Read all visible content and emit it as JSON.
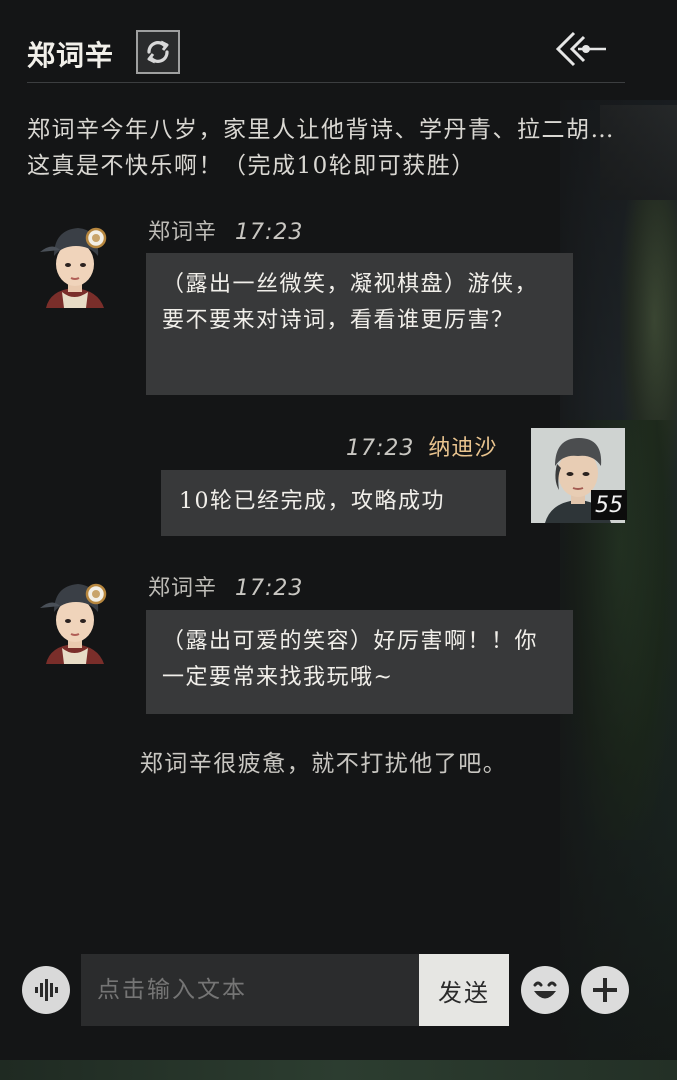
{
  "header": {
    "title": "郑词辛",
    "refresh_icon": "refresh-icon",
    "back_icon": "back-arrow-icon"
  },
  "intro": "郑词辛今年八岁，家里人让他背诗、学丹青、拉二胡…这真是不快乐啊！（完成10轮即可获胜）",
  "messages": [
    {
      "sender": "郑词辛",
      "time": "17:23",
      "text": "（露出一丝微笑，凝视棋盘）游侠，要不要来对诗词，看看谁更厉害？"
    },
    {
      "sender": "纳迪沙",
      "time": "17:23",
      "text": "10轮已经完成，攻略成功",
      "level": "55"
    },
    {
      "sender": "郑词辛",
      "time": "17:23",
      "text": "（露出可爱的笑容）好厉害啊！！你一定要常来找我玩哦~"
    }
  ],
  "notice": "郑词辛很疲惫，就不打扰他了吧。",
  "input": {
    "placeholder": "点击输入文本",
    "send_label": "发送"
  },
  "colors": {
    "background": "#141516",
    "bubble": "#38393a",
    "self_name": "#e9c48f"
  }
}
